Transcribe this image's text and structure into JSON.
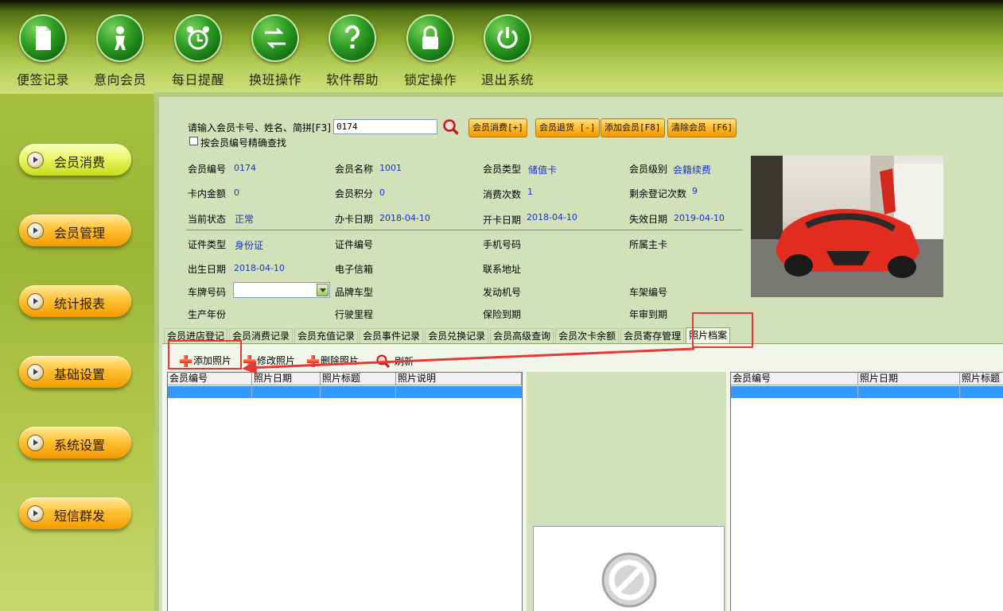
{
  "toolbar": {
    "items": [
      {
        "label": "便签记录",
        "icon": "notes-icon"
      },
      {
        "label": "意向会员",
        "icon": "person-icon"
      },
      {
        "label": "每日提醒",
        "icon": "alarm-clock-icon"
      },
      {
        "label": "换班操作",
        "icon": "swap-arrows-icon"
      },
      {
        "label": "软件帮助",
        "icon": "help-icon"
      },
      {
        "label": "锁定操作",
        "icon": "lock-icon"
      },
      {
        "label": "退出系统",
        "icon": "power-icon"
      }
    ]
  },
  "sidebar": {
    "items": [
      {
        "label": "会员消费"
      },
      {
        "label": "会员管理"
      },
      {
        "label": "统计报表"
      },
      {
        "label": "基础设置"
      },
      {
        "label": "系统设置"
      },
      {
        "label": "短信群发"
      }
    ]
  },
  "search": {
    "label": "请输入会员卡号、姓名、简拼[F3]",
    "value": "0174",
    "exact_label": "按会员编号精确查找"
  },
  "actions": {
    "consume": "会员消费[+]",
    "refund": "会员退货 [-]",
    "add": "添加会员[F8]",
    "clear": "清除会员 [F6]"
  },
  "member": {
    "id_label": "会员编号",
    "id": "0174",
    "name_label": "会员名称",
    "name": "1001",
    "type_label": "会员类型",
    "type": "储值卡",
    "level_label": "会员级别",
    "level": "会籍续费",
    "balance_label": "卡内金额",
    "balance": "0",
    "points_label": "会员积分",
    "points": "0",
    "visits_label": "消费次数",
    "visits": "1",
    "remaining_label": "剩余登记次数",
    "remaining": "9",
    "status_label": "当前状态",
    "status": "正常",
    "issue_label": "办卡日期",
    "issue": "2018-04-10",
    "open_label": "开卡日期",
    "open": "2018-04-10",
    "expire_label": "失效日期",
    "expire": "2019-04-10",
    "cert_type_label": "证件类型",
    "cert_type": "身份证",
    "cert_no_label": "证件编号",
    "phone_label": "手机号码",
    "owner_label": "所属主卡",
    "birth_label": "出生日期",
    "birth": "2018-04-10",
    "email_label": "电子信箱",
    "address_label": "联系地址",
    "plate_label": "车牌号码",
    "brand_label": "品牌车型",
    "engine_label": "发动机号",
    "frame_label": "车架编号",
    "year_label": "生产年份",
    "mileage_label": "行驶里程",
    "insurance_label": "保险到期",
    "inspection_label": "年审到期"
  },
  "tabs": [
    {
      "label": "会员进店登记"
    },
    {
      "label": "会员消费记录"
    },
    {
      "label": "会员充值记录"
    },
    {
      "label": "会员事件记录"
    },
    {
      "label": "会员兑换记录"
    },
    {
      "label": "会员高级查询"
    },
    {
      "label": "会员次卡余额"
    },
    {
      "label": "会员寄存管理"
    },
    {
      "label": "照片档案",
      "active": true
    }
  ],
  "photo_toolbar": {
    "add": "添加照片",
    "edit": "修改照片",
    "delete": "删除照片",
    "refresh": "刷新"
  },
  "left_grid": {
    "columns": [
      "会员编号",
      "照片日期",
      "照片标题",
      "照片说明"
    ]
  },
  "right_grid": {
    "columns": [
      "会员编号",
      "照片日期",
      "照片标题"
    ]
  },
  "colors": {
    "accent_orange": "#ffb626",
    "value_blue": "#1633c7",
    "selection_blue": "#3399ff",
    "annotation_red": "#e53935"
  }
}
